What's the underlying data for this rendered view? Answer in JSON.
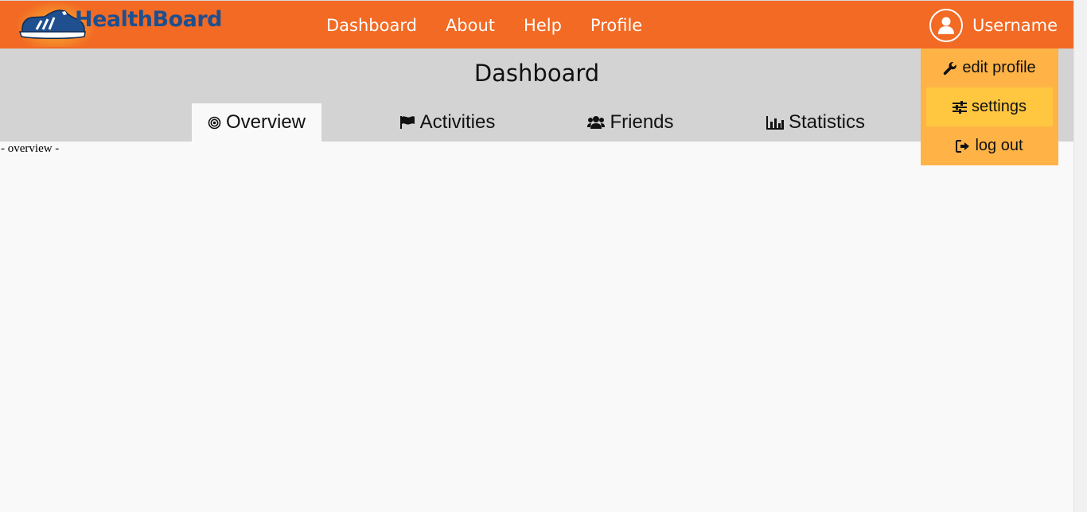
{
  "brand": {
    "name": "HealthBoard"
  },
  "nav": [
    {
      "label": "Dashboard"
    },
    {
      "label": "About"
    },
    {
      "label": "Help"
    },
    {
      "label": "Profile"
    }
  ],
  "user": {
    "name": "Username",
    "icon": "user-avatar-icon"
  },
  "page": {
    "title": "Dashboard"
  },
  "tabs": [
    {
      "label": "Overview",
      "icon": "bullseye-icon",
      "active": true
    },
    {
      "label": "Activities",
      "icon": "flag-icon",
      "active": false
    },
    {
      "label": "Friends",
      "icon": "users-icon",
      "active": false
    },
    {
      "label": "Statistics",
      "icon": "bar-chart-icon",
      "active": false
    }
  ],
  "content": {
    "text": "- overview -"
  },
  "user_menu": [
    {
      "label": "edit profile",
      "icon": "wrench-icon"
    },
    {
      "label": "settings",
      "icon": "sliders-icon",
      "hovered": true
    },
    {
      "label": "log out",
      "icon": "sign-out-icon"
    }
  ],
  "colors": {
    "topbar": "#f26a24",
    "brand_text": "#1f4f8e",
    "subheader": "#d3d3d3",
    "dropdown": "#ffb347",
    "dropdown_hover": "#ffc640",
    "background": "#f9f9f9"
  }
}
